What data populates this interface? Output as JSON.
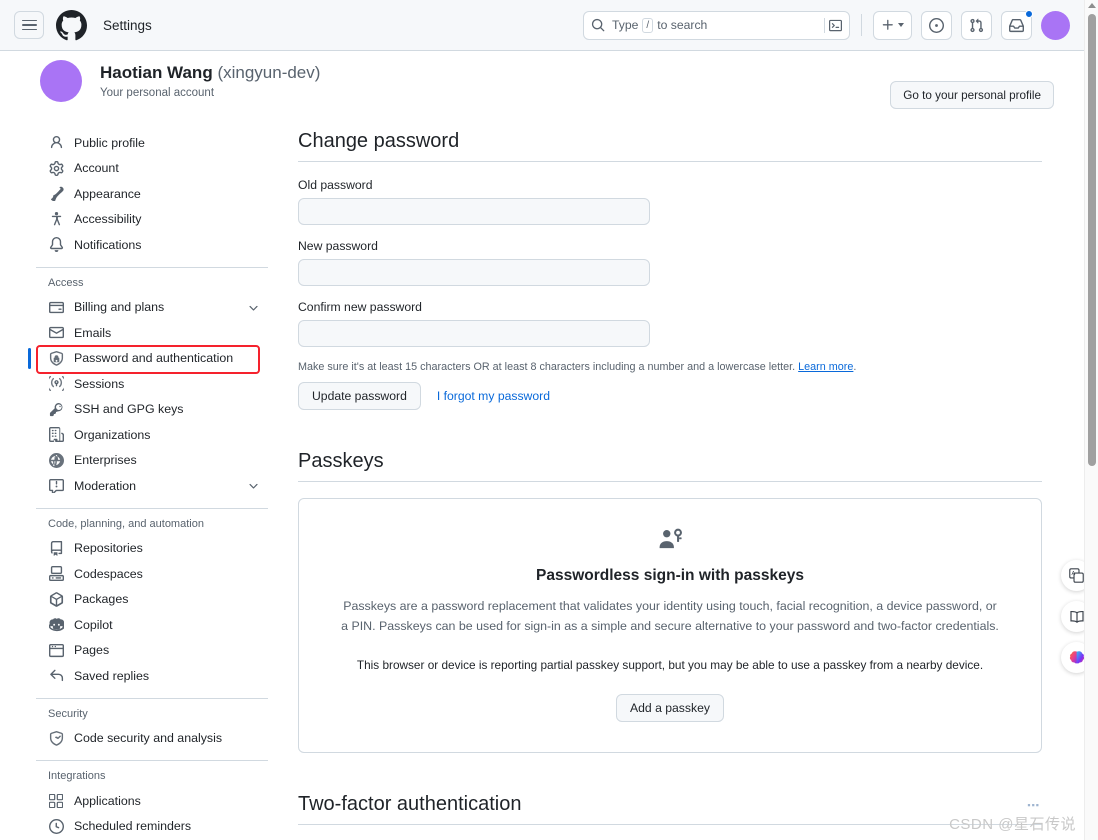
{
  "header": {
    "menu_icon": "hamburger-icon",
    "logo_icon": "github-logo",
    "title": "Settings",
    "search": {
      "icon": "search-icon",
      "placeholder_prefix": "Type",
      "key_hint": "/",
      "placeholder_suffix": "to search",
      "terminal_icon": "terminal-icon"
    },
    "actions": [
      {
        "name": "create-new-button",
        "icon": "plus-icon",
        "label": "+"
      },
      {
        "name": "issues-button",
        "icon": "issue-opened-icon"
      },
      {
        "name": "pull-requests-button",
        "icon": "git-pull-request-icon"
      },
      {
        "name": "notifications-button",
        "icon": "inbox-icon",
        "has_badge": true
      }
    ],
    "avatar": {
      "name": "user-avatar",
      "color": "#a974f5"
    }
  },
  "profile": {
    "name": "Haotian Wang",
    "handle": "(xingyun-dev)",
    "subtitle": "Your personal account",
    "go_to_profile_label": "Go to your personal profile",
    "avatar_color": "#a974f5"
  },
  "sidebar": {
    "groups": [
      {
        "heading": null,
        "items": [
          {
            "label": "Public profile",
            "icon": "person-icon",
            "active": false,
            "chevron": false
          },
          {
            "label": "Account",
            "icon": "gear-icon",
            "active": false,
            "chevron": false
          },
          {
            "label": "Appearance",
            "icon": "paintbrush-icon",
            "active": false,
            "chevron": false
          },
          {
            "label": "Accessibility",
            "icon": "accessibility-icon",
            "active": false,
            "chevron": false
          },
          {
            "label": "Notifications",
            "icon": "bell-icon",
            "active": false,
            "chevron": false
          }
        ]
      },
      {
        "heading": "Access",
        "items": [
          {
            "label": "Billing and plans",
            "icon": "credit-card-icon",
            "active": false,
            "chevron": true
          },
          {
            "label": "Emails",
            "icon": "mail-icon",
            "active": false,
            "chevron": false
          },
          {
            "label": "Password and authentication",
            "icon": "shield-lock-icon",
            "active": true,
            "chevron": false
          },
          {
            "label": "Sessions",
            "icon": "broadcast-icon",
            "active": false,
            "chevron": false
          },
          {
            "label": "SSH and GPG keys",
            "icon": "key-icon",
            "active": false,
            "chevron": false
          },
          {
            "label": "Organizations",
            "icon": "organization-icon",
            "active": false,
            "chevron": false
          },
          {
            "label": "Enterprises",
            "icon": "globe-icon",
            "active": false,
            "chevron": false
          },
          {
            "label": "Moderation",
            "icon": "report-icon",
            "active": false,
            "chevron": true
          }
        ]
      },
      {
        "heading": "Code, planning, and automation",
        "items": [
          {
            "label": "Repositories",
            "icon": "repo-icon",
            "active": false,
            "chevron": false
          },
          {
            "label": "Codespaces",
            "icon": "codespaces-icon",
            "active": false,
            "chevron": false
          },
          {
            "label": "Packages",
            "icon": "package-icon",
            "active": false,
            "chevron": false
          },
          {
            "label": "Copilot",
            "icon": "copilot-icon",
            "active": false,
            "chevron": false
          },
          {
            "label": "Pages",
            "icon": "browser-icon",
            "active": false,
            "chevron": false
          },
          {
            "label": "Saved replies",
            "icon": "reply-icon",
            "active": false,
            "chevron": false
          }
        ]
      },
      {
        "heading": "Security",
        "items": [
          {
            "label": "Code security and analysis",
            "icon": "shield-check-icon",
            "active": false,
            "chevron": false
          }
        ]
      },
      {
        "heading": "Integrations",
        "items": [
          {
            "label": "Applications",
            "icon": "apps-icon",
            "active": false,
            "chevron": false
          },
          {
            "label": "Scheduled reminders",
            "icon": "clock-icon",
            "active": false,
            "chevron": false
          }
        ]
      }
    ],
    "highlight_annotation": {
      "color": "#f5222d",
      "target": "Password and authentication"
    }
  },
  "main": {
    "change_password": {
      "title": "Change password",
      "fields": [
        {
          "label": "Old password",
          "name": "old-password-input",
          "value": ""
        },
        {
          "label": "New password",
          "name": "new-password-input",
          "value": ""
        },
        {
          "label": "Confirm new password",
          "name": "confirm-password-input",
          "value": ""
        }
      ],
      "hint": "Make sure it's at least 15 characters OR at least 8 characters including a number and a lowercase letter.",
      "hint_link": "Learn more",
      "update_button": "Update password",
      "forgot_link": "I forgot my password"
    },
    "passkeys": {
      "title": "Passkeys",
      "card_icon": "person-key-icon",
      "card_title": "Passwordless sign-in with passkeys",
      "card_body": "Passkeys are a password replacement that validates your identity using touch, facial recognition, a device password, or a PIN. Passkeys can be used for sign-in as a simple and secure alternative to your password and two-factor credentials.",
      "card_note": "This browser or device is reporting partial passkey support, but you may be able to use a passkey from a nearby device.",
      "add_button": "Add a passkey"
    },
    "two_factor": {
      "title": "Two-factor authentication"
    }
  },
  "float_toolbar": [
    {
      "name": "translate-icon"
    },
    {
      "name": "dictionary-icon"
    },
    {
      "name": "ai-brain-icon"
    }
  ],
  "watermark": {
    "text": "CSDN @星石传说"
  }
}
